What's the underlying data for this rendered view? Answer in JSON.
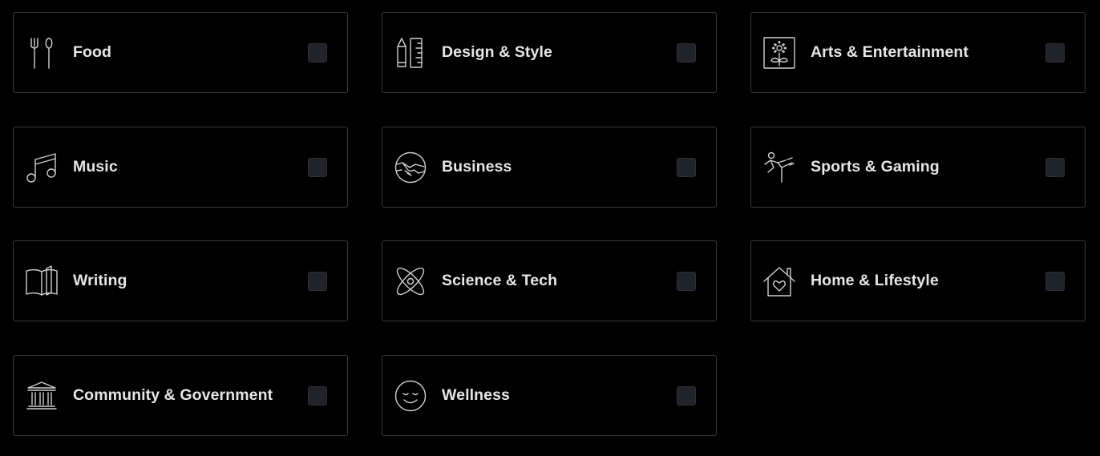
{
  "categories": [
    {
      "label": "Food",
      "icon": "fork-spoon-icon",
      "checked": false
    },
    {
      "label": "Design & Style",
      "icon": "pencil-ruler-icon",
      "checked": false
    },
    {
      "label": "Arts & Entertainment",
      "icon": "framed-flower-icon",
      "checked": false
    },
    {
      "label": "Music",
      "icon": "music-note-icon",
      "checked": false
    },
    {
      "label": "Business",
      "icon": "handshake-icon",
      "checked": false
    },
    {
      "label": "Sports & Gaming",
      "icon": "kicking-figure-icon",
      "checked": false
    },
    {
      "label": "Writing",
      "icon": "open-book-icon",
      "checked": false
    },
    {
      "label": "Science & Tech",
      "icon": "atom-icon",
      "checked": false
    },
    {
      "label": "Home & Lifestyle",
      "icon": "house-heart-icon",
      "checked": false
    },
    {
      "label": "Community & Government",
      "icon": "government-building-icon",
      "checked": false
    },
    {
      "label": "Wellness",
      "icon": "smiley-face-icon",
      "checked": false
    }
  ],
  "colors": {
    "background": "#000000",
    "card_border": "#3a3a3e",
    "label_text": "#e6e6e6",
    "icon_stroke": "#cfcfcf",
    "checkbox_fill": "#212328"
  }
}
